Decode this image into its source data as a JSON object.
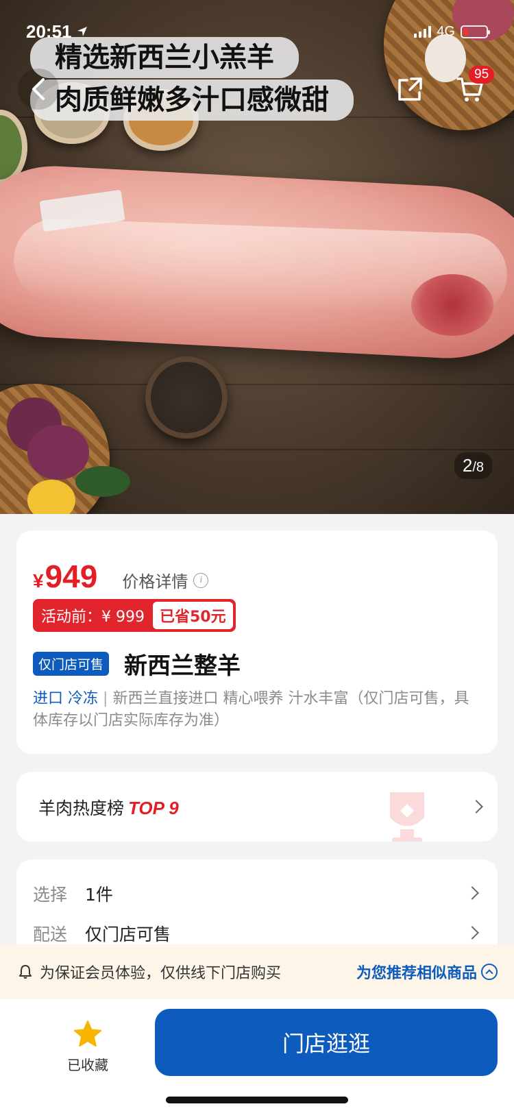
{
  "status_bar": {
    "time": "20:51",
    "network": "4G"
  },
  "hero": {
    "caption_line1": "精选新西兰小羔羊",
    "caption_line2": "肉质鲜嫩多汁口感微甜",
    "cart_count": "95",
    "pager_current": "2",
    "pager_total": "/8"
  },
  "price": {
    "symbol": "¥",
    "value": "949",
    "detail_label": "价格详情",
    "before_label": "活动前：¥ 999",
    "save_label": "已省50元"
  },
  "product": {
    "store_tag": "仅门店可售",
    "title": "新西兰整羊",
    "tag1": "进口",
    "tag2": "冷冻",
    "separator": "|",
    "description": "新西兰直接进口 精心喂养 汁水丰富（仅门店可售，具体库存以门店实际库存为准）"
  },
  "ranking": {
    "label": "羊肉热度榜",
    "top": "TOP 9"
  },
  "options": [
    {
      "key": "选择",
      "value": "1件"
    },
    {
      "key": "配送",
      "value": "仅门店可售"
    }
  ],
  "notice": {
    "text": "为保证会员体验，仅供线下门店购买",
    "link": "为您推荐相似商品"
  },
  "bottom_bar": {
    "favorite_label": "已收藏",
    "visit_button": "门店逛逛"
  },
  "colors": {
    "accent_blue": "#0c5bbd",
    "price_red": "#e31e24",
    "star_yellow": "#f7b500"
  }
}
